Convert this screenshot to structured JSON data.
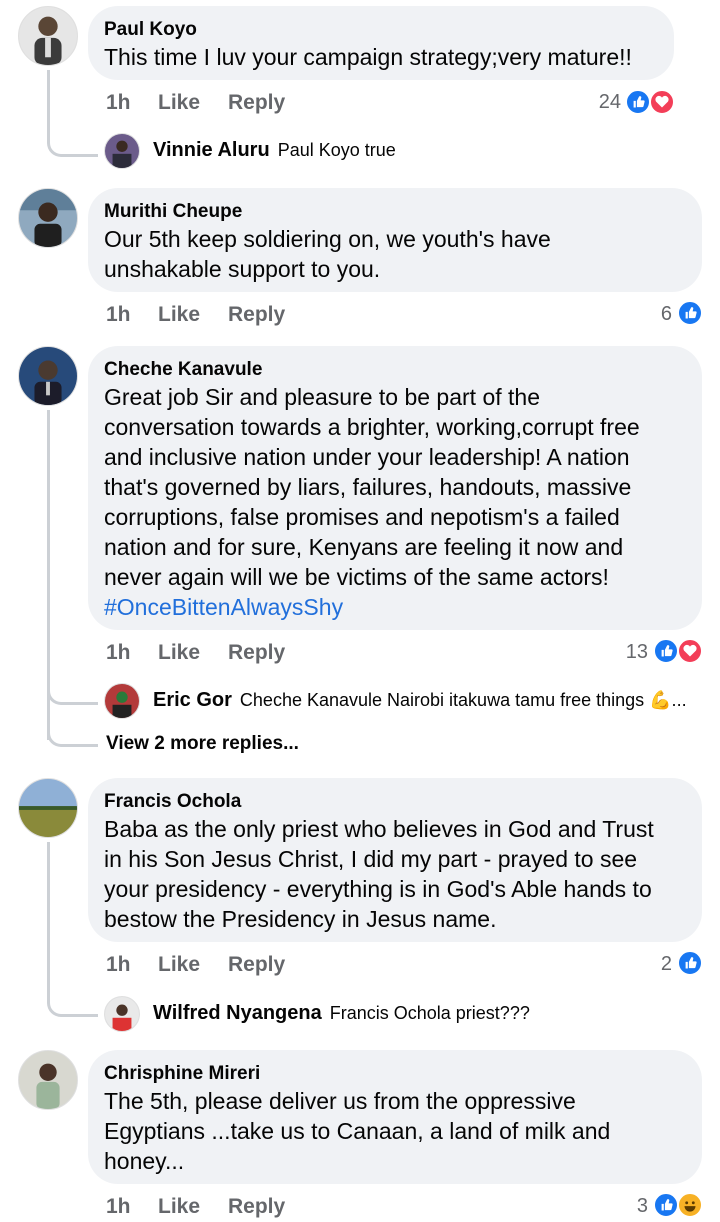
{
  "labels": {
    "like": "Like",
    "reply": "Reply"
  },
  "comments": [
    {
      "author": "Paul Koyo",
      "text": "This time I luv your campaign strategy;very mature!!",
      "time": "1h",
      "reaction_count": "24",
      "reactions": [
        "like-icon",
        "love-icon"
      ],
      "replies": [
        {
          "author": "Vinnie Aluru",
          "text": "Paul Koyo true"
        }
      ]
    },
    {
      "author": "Murithi Cheupe",
      "text_lines": [
        "Our 5th keep soldiering on, we youth's have",
        "unshakable  support to you."
      ],
      "time": "1h",
      "reaction_count": "6",
      "reactions": [
        "like-icon"
      ]
    },
    {
      "author": "Cheche Kanavule",
      "text_lines": [
        "Great job Sir and pleasure to be part of the",
        "conversation towards a brighter, working,corrupt free",
        "and inclusive nation under your leadership! A nation",
        "that's governed by liars, failures, handouts, massive",
        "corruptions, false promises and nepotism's a failed",
        "nation and for sure, Kenyans are feeling it now and",
        "never again will we be victims of the same actors!"
      ],
      "hashtag": "#OnceBittenAlwaysShy",
      "time": "1h",
      "reaction_count": "13",
      "reactions": [
        "like-icon",
        "love-icon"
      ],
      "replies": [
        {
          "author": "Eric Gor",
          "text": "Cheche Kanavule Nairobi itakuwa tamu free things 💪..."
        }
      ],
      "more_replies": "View 2 more replies..."
    },
    {
      "author": "Francis Ochola",
      "text_lines": [
        "Baba as the only priest who believes in God and Trust",
        "in his Son Jesus Christ, I did my part - prayed to see",
        "your presidency - everything is in God's Able hands to",
        "bestow the Presidency in Jesus name."
      ],
      "time": "1h",
      "reaction_count": "2",
      "reactions": [
        "like-icon"
      ],
      "replies": [
        {
          "author": "Wilfred Nyangena",
          "text": "Francis Ochola priest???"
        }
      ]
    },
    {
      "author": "Chrisphine Mireri",
      "text_lines": [
        "The 5th, please deliver us from the oppressive",
        "Egyptians ...take us to Canaan, a land of milk and",
        "honey..."
      ],
      "time": "1h",
      "reaction_count": "3",
      "reactions": [
        "like-icon",
        "haha-icon"
      ]
    }
  ],
  "colors": {
    "bubble": "#f0f2f5",
    "meta": "#65676b",
    "link": "#216fdb",
    "like": "#1877f2",
    "love": "#f33e58",
    "haha": "#f7b125"
  }
}
